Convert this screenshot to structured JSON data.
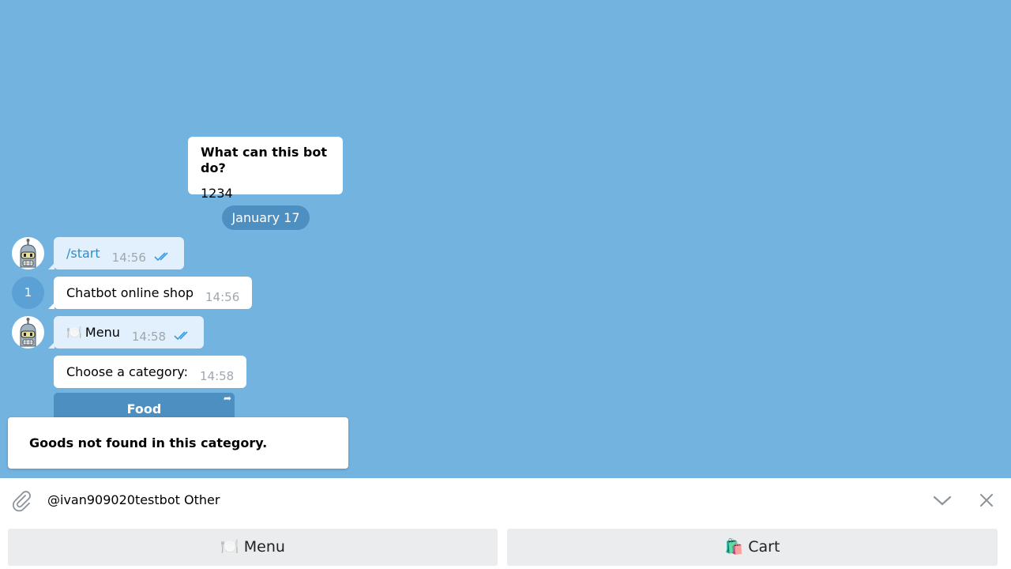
{
  "bot_info": {
    "title": "What can this bot do?",
    "description": "1234"
  },
  "date_divider": "January 17",
  "messages": [
    {
      "text": "/start",
      "time": "14:56"
    },
    {
      "avatar_number": "1",
      "text": "Chatbot online shop",
      "time": "14:56"
    },
    {
      "icon": "🍽️",
      "text": "Menu",
      "time": "14:58"
    },
    {
      "text": "Choose a category:",
      "time": "14:58"
    }
  ],
  "inline_keyboard": {
    "button_label": "Food"
  },
  "toast": {
    "text": "Goods not found in this category."
  },
  "composer": {
    "value": "@ivan909020testbot Other"
  },
  "reply_keyboard": {
    "menu_icon": "🍽️",
    "menu_label": "Menu",
    "cart_icon": "🛍️",
    "cart_label": "Cart"
  },
  "icons": {
    "attach": "paperclip-icon",
    "chevron": "chevron-down-icon",
    "close": "close-icon",
    "read_receipt": "double-check-icon",
    "share": "share-icon"
  },
  "colors": {
    "background": "#73b3e0",
    "outgoing_bubble": "#e1f0fc",
    "accent": "#4d8fc1",
    "link": "#2a8fcf"
  }
}
